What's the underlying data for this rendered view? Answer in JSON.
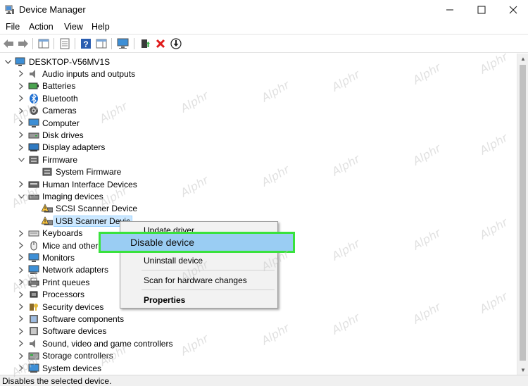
{
  "window": {
    "title": "Device Manager",
    "minimize": "—",
    "maximize": "☐",
    "close": "✕"
  },
  "menu": [
    "File",
    "Action",
    "View",
    "Help"
  ],
  "toolbar": {
    "back_icon": "arrow-left-icon",
    "forward_icon": "arrow-right-icon"
  },
  "tree": {
    "root": "DESKTOP-V56MV1S",
    "items": [
      {
        "label": "Audio inputs and outputs",
        "icon": "speaker-icon",
        "level": 1,
        "expanded": false
      },
      {
        "label": "Batteries",
        "icon": "battery-icon",
        "level": 1,
        "expanded": false
      },
      {
        "label": "Bluetooth",
        "icon": "bluetooth-icon",
        "level": 1,
        "expanded": false
      },
      {
        "label": "Cameras",
        "icon": "camera-icon",
        "level": 1,
        "expanded": false
      },
      {
        "label": "Computer",
        "icon": "computer-icon",
        "level": 1,
        "expanded": false
      },
      {
        "label": "Disk drives",
        "icon": "disk-icon",
        "level": 1,
        "expanded": false
      },
      {
        "label": "Display adapters",
        "icon": "display-adapter-icon",
        "level": 1,
        "expanded": false
      },
      {
        "label": "Firmware",
        "icon": "firmware-icon",
        "level": 1,
        "expanded": true
      },
      {
        "label": "System Firmware",
        "icon": "firmware-icon",
        "level": 2
      },
      {
        "label": "Human Interface Devices",
        "icon": "hid-icon",
        "level": 1,
        "expanded": false
      },
      {
        "label": "Imaging devices",
        "icon": "scanner-icon",
        "level": 1,
        "expanded": true
      },
      {
        "label": "SCSI Scanner Device",
        "icon": "warning-scanner-icon",
        "level": 2
      },
      {
        "label": "USB Scanner Devic",
        "icon": "warning-scanner-icon",
        "level": 2,
        "selected": true
      },
      {
        "label": "Keyboards",
        "icon": "keyboard-icon",
        "level": 1,
        "expanded": false
      },
      {
        "label": "Mice and other",
        "icon": "mouse-icon",
        "level": 1,
        "expanded": false
      },
      {
        "label": "Monitors",
        "icon": "monitor-icon",
        "level": 1,
        "expanded": false
      },
      {
        "label": "Network adapters",
        "icon": "network-icon",
        "level": 1,
        "expanded": false
      },
      {
        "label": "Print queues",
        "icon": "printer-icon",
        "level": 1,
        "expanded": false
      },
      {
        "label": "Processors",
        "icon": "cpu-icon",
        "level": 1,
        "expanded": false
      },
      {
        "label": "Security devices",
        "icon": "security-icon",
        "level": 1,
        "expanded": false
      },
      {
        "label": "Software components",
        "icon": "software-component-icon",
        "level": 1,
        "expanded": false
      },
      {
        "label": "Software devices",
        "icon": "software-device-icon",
        "level": 1,
        "expanded": false
      },
      {
        "label": "Sound, video and game controllers",
        "icon": "sound-icon",
        "level": 1,
        "expanded": false
      },
      {
        "label": "Storage controllers",
        "icon": "storage-icon",
        "level": 1,
        "expanded": false
      },
      {
        "label": "System devices",
        "icon": "system-icon",
        "level": 1,
        "expanded": false
      }
    ]
  },
  "context_menu": {
    "update_driver": "Update driver",
    "disable_device": "Disable device",
    "uninstall_device": "Uninstall device",
    "scan_changes": "Scan for hardware changes",
    "properties": "Properties"
  },
  "status": "Disables the selected device.",
  "watermark": "Alphr",
  "colors": {
    "highlight_border": "#39e23d",
    "highlight_fill": "#9acdf3",
    "selection": "#cce8ff"
  }
}
